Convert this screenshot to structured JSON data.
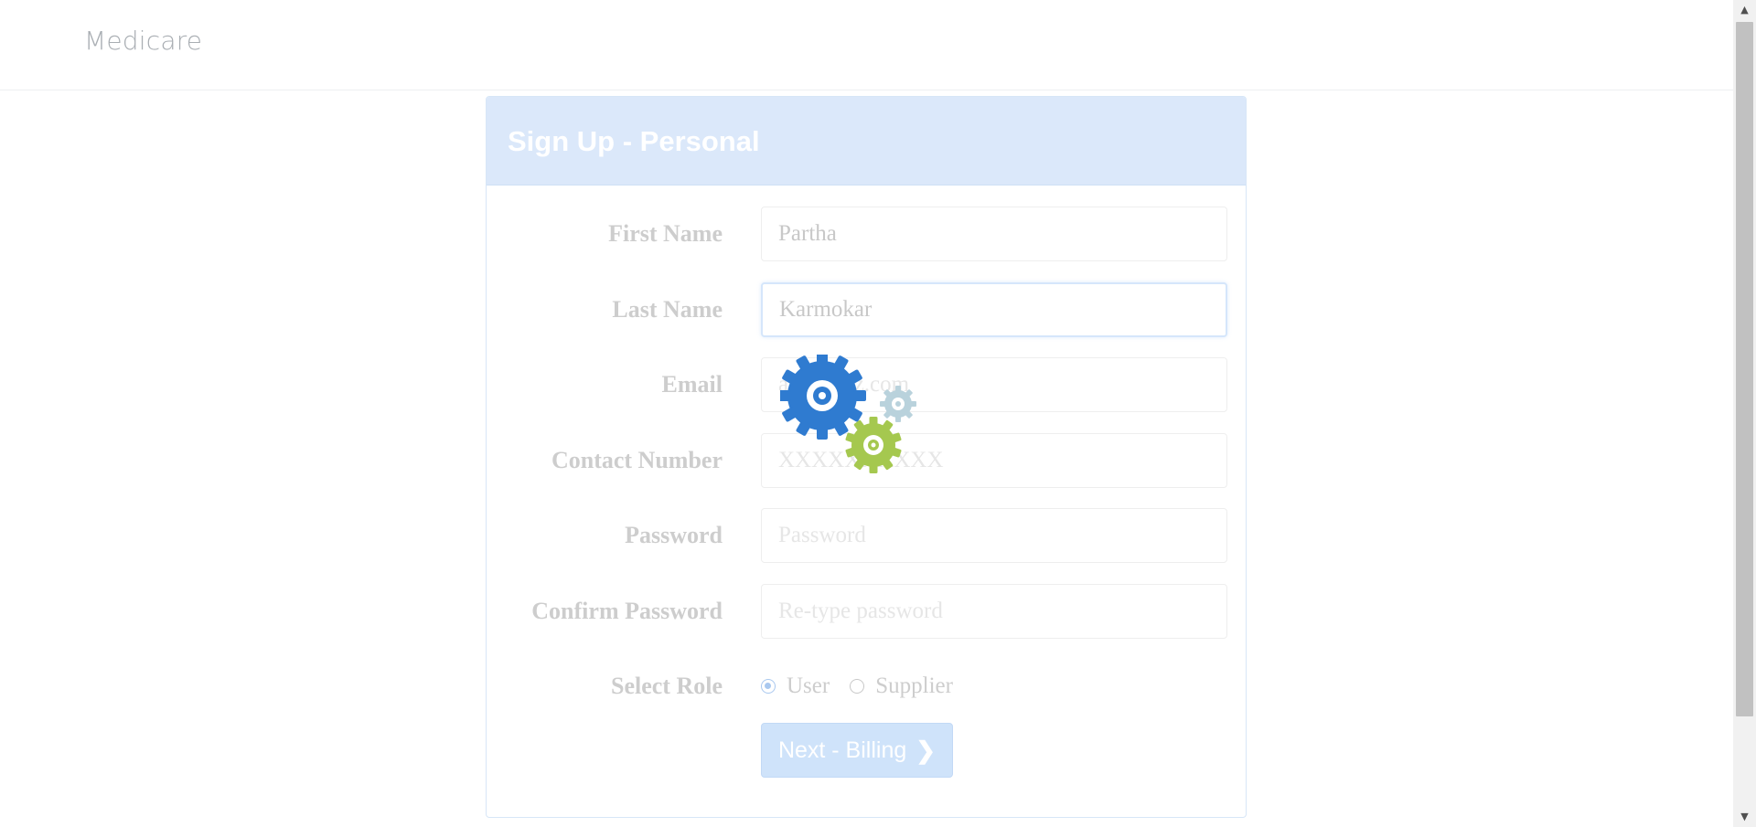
{
  "navbar": {
    "brand": "Medicare"
  },
  "form": {
    "title": "Sign Up - Personal",
    "fields": [
      {
        "label": "First Name",
        "value": "Partha",
        "placeholder": ""
      },
      {
        "label": "Last Name",
        "value": "Karmokar",
        "placeholder": ""
      },
      {
        "label": "Email",
        "value": "",
        "placeholder": "abc@xyz.com"
      },
      {
        "label": "Contact Number",
        "value": "",
        "placeholder": "XXXXXXXXXX"
      },
      {
        "label": "Password",
        "value": "",
        "placeholder": "Password"
      },
      {
        "label": "Confirm Password",
        "value": "",
        "placeholder": "Re-type password"
      }
    ],
    "role": {
      "label": "Select Role",
      "options": [
        "User",
        "Supplier"
      ],
      "selected": "User"
    },
    "next_button": "Next - Billing",
    "next_icon": "chevron-right-icon"
  },
  "loading": {
    "icon": "gears-icon",
    "colors": [
      "#2f7bd0",
      "#b9d2dc",
      "#a5c84f"
    ]
  },
  "colors": {
    "header_bg": "#dbe8fa",
    "button_bg": "#cfe3fa"
  }
}
